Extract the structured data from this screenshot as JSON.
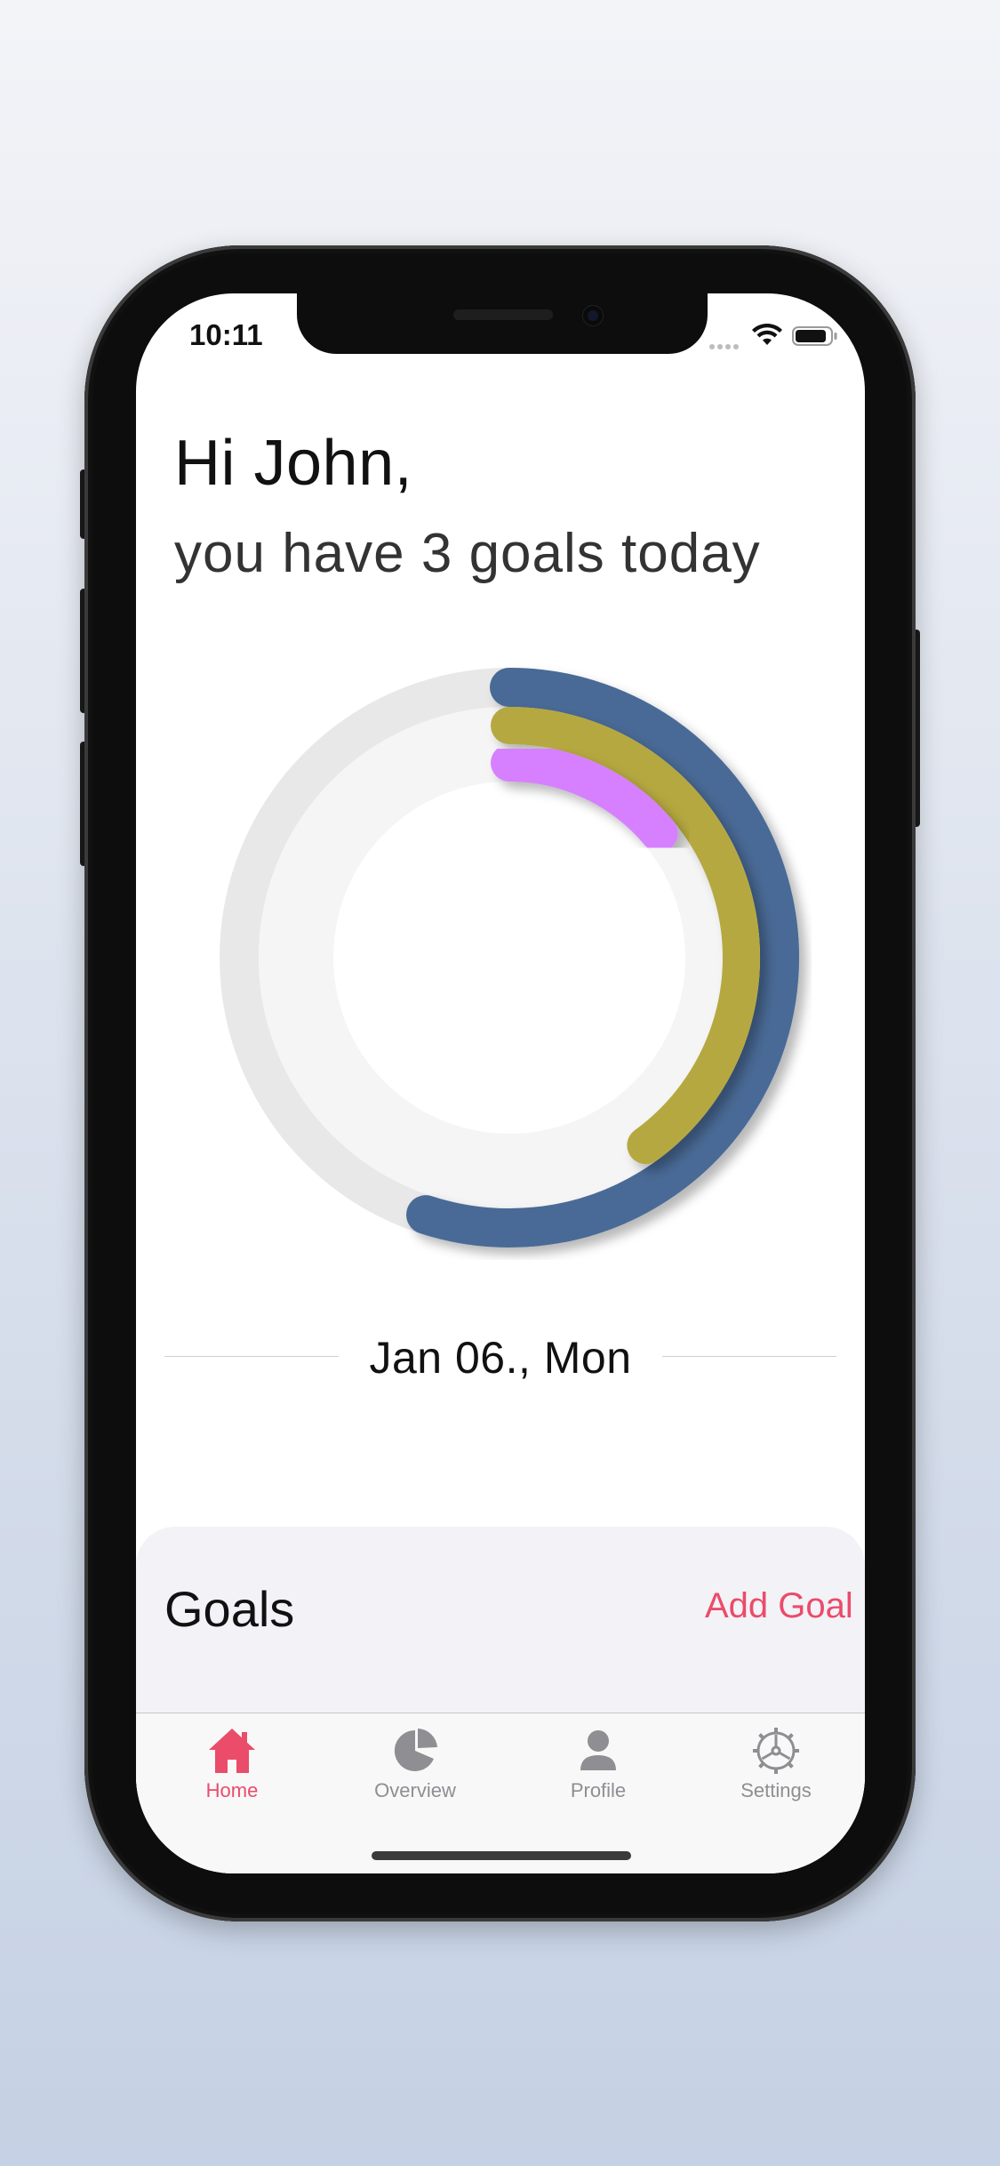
{
  "status_bar": {
    "time": "10:11"
  },
  "header": {
    "greeting": "Hi John,",
    "subtitle": "you have 3 goals today"
  },
  "colors": {
    "accent": "#ea4c6a",
    "ring_outer": "#4a6a96",
    "ring_middle": "#b5a841",
    "ring_inner": "#d680ff",
    "track_outer": "#e8e8e8",
    "track_middle": "#f5f5f5"
  },
  "rings": [
    {
      "name": "outer",
      "progress": 0.55
    },
    {
      "name": "middle",
      "progress": 0.4
    },
    {
      "name": "inner",
      "progress": 0.14
    }
  ],
  "date": {
    "label": "Jan 06., Mon"
  },
  "goals": {
    "title": "Goals",
    "add_label": "Add Goal"
  },
  "tab_bar": {
    "items": [
      {
        "label": "Home",
        "icon": "house-icon",
        "active": true
      },
      {
        "label": "Overview",
        "icon": "pie-chart-icon",
        "active": false
      },
      {
        "label": "Profile",
        "icon": "person-icon",
        "active": false
      },
      {
        "label": "Settings",
        "icon": "gear-icon",
        "active": false
      }
    ]
  }
}
